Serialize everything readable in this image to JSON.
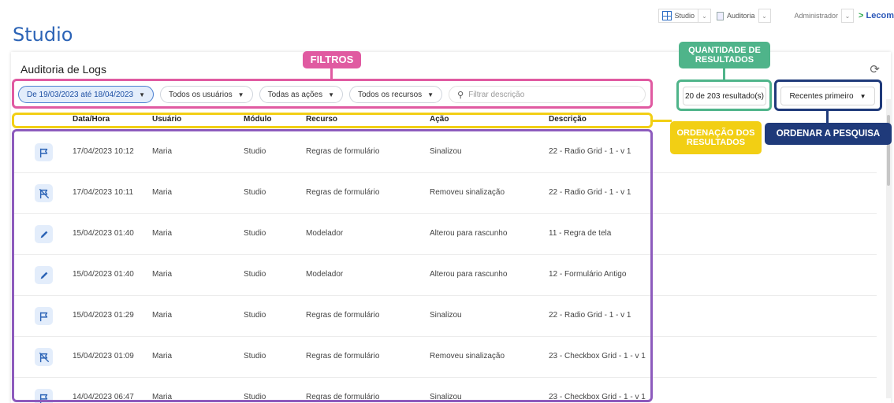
{
  "topbar": {
    "studio_label": "Studio",
    "auditoria_label": "Auditoria",
    "user_label": "Administrador",
    "brand": "Lecom"
  },
  "app_title": "Studio",
  "page": {
    "title": "Auditoria de Logs"
  },
  "annotations": {
    "filtros": "FILTROS",
    "quantidade": "QUANTIDADE DE RESULTADOS",
    "ordenacao_resultados": "ORDENAÇÃO DOS RESULTADOS",
    "ordenar_pesquisa": "ORDENAR A PESQUISA"
  },
  "filters": {
    "date_range": "De 19/03/2023 até 18/04/2023",
    "users": "Todos os usuários",
    "actions": "Todas as ações",
    "resources": "Todos os recursos",
    "search_placeholder": "Filtrar descrição"
  },
  "result_count": "20 de 203 resultado(s)",
  "sort_label": "Recentes primeiro",
  "table": {
    "columns": [
      "Data/Hora",
      "Usuário",
      "Módulo",
      "Recurso",
      "Ação",
      "Descrição"
    ],
    "rows": [
      {
        "icon": "flag-icon",
        "datetime": "17/04/2023 10:12",
        "user": "Maria",
        "module": "Studio",
        "resource": "Regras de formulário",
        "action": "Sinalizou",
        "description": "22 - Radio Grid - 1 - v 1"
      },
      {
        "icon": "flag-off-icon",
        "datetime": "17/04/2023 10:11",
        "user": "Maria",
        "module": "Studio",
        "resource": "Regras de formulário",
        "action": "Removeu sinalização",
        "description": "22 - Radio Grid - 1 - v 1"
      },
      {
        "icon": "pencil-icon",
        "datetime": "15/04/2023 01:40",
        "user": "Maria",
        "module": "Studio",
        "resource": "Modelador",
        "action": "Alterou para rascunho",
        "description": "11 - Regra de tela"
      },
      {
        "icon": "pencil-icon",
        "datetime": "15/04/2023 01:40",
        "user": "Maria",
        "module": "Studio",
        "resource": "Modelador",
        "action": "Alterou para rascunho",
        "description": "12 - Formulário Antigo"
      },
      {
        "icon": "flag-icon",
        "datetime": "15/04/2023 01:29",
        "user": "Maria",
        "module": "Studio",
        "resource": "Regras de formulário",
        "action": "Sinalizou",
        "description": "22 - Radio Grid - 1 - v 1"
      },
      {
        "icon": "flag-off-icon",
        "datetime": "15/04/2023 01:09",
        "user": "Maria",
        "module": "Studio",
        "resource": "Regras de formulário",
        "action": "Removeu sinalização",
        "description": "23 - Checkbox Grid - 1 - v 1"
      },
      {
        "icon": "flag-icon",
        "datetime": "14/04/2023 06:47",
        "user": "Maria",
        "module": "Studio",
        "resource": "Regras de formulário",
        "action": "Sinalizou",
        "description": "23 - Checkbox Grid - 1 - v 1"
      }
    ]
  },
  "colors": {
    "accent": "#2b63b6",
    "filtros": "#e05aa1",
    "quantidade": "#4fb48a",
    "ordenacao": "#f2cf14",
    "ordenar": "#1f3a7a",
    "resultados_box": "#8d5bbd"
  }
}
